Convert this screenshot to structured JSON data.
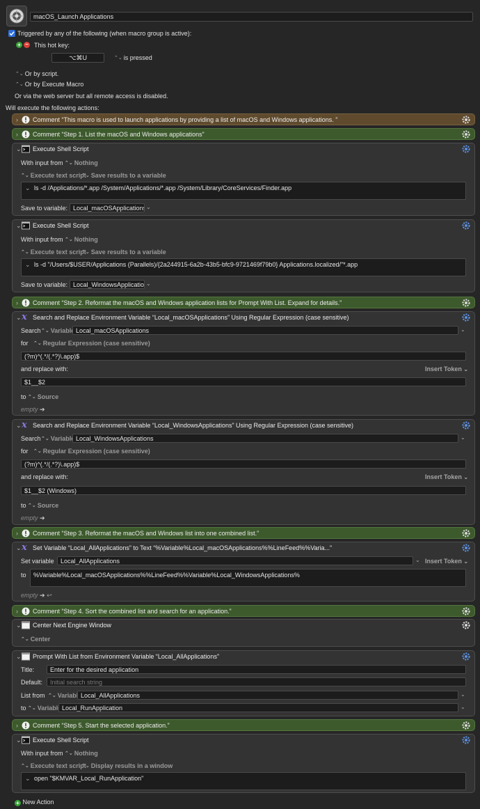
{
  "macro": {
    "name": "macOS_Launch Applications",
    "trigger_checkbox_label": "Triggered by any of the following (when macro group is active):",
    "hotkey_label": "This hot key:",
    "hotkey_value": "⌥⌘U",
    "hotkey_state": "is pressed",
    "or_by_script": "Or by script.",
    "or_by_execute_macro": "Or by Execute Macro",
    "web_server_note": "Or via the web server but all remote access is disabled.",
    "will_execute": "Will execute the following actions:"
  },
  "actions": {
    "comment1": "Comment “This macro is used to launch applications by providing a list of macOS and Windows applications.  ”",
    "comment2": "Comment “Step 1. List the macOS and Windows applications”",
    "shell1": {
      "title": "Execute Shell Script",
      "with_input_label": "With input from",
      "with_input_value": "Nothing",
      "option1": "Execute text script",
      "option2": "Save results to a variable",
      "script": "ls -d /Applications/*.app /System/Applications/*.app /System/Library/CoreServices/Finder.app",
      "save_label": "Save to variable:",
      "save_value": "Local_macOSApplications"
    },
    "shell2": {
      "title": "Execute Shell Script",
      "with_input_label": "With input from",
      "with_input_value": "Nothing",
      "option1": "Execute text script",
      "option2": "Save results to a variable",
      "script": "ls -d \"/Users/$USER/Applications (Parallels)/{2a244915-6a2b-43b5-bfc9-9721469f79b0} Applications.localized/\"*.app",
      "save_label": "Save to variable:",
      "save_value": "Local_WindowsApplication"
    },
    "comment3": "Comment “Step 2. Reformat the macOS and Windows application lists for Prompt With List. Expand for details.”",
    "sr1": {
      "title": "Search and Replace Environment Variable “Local_macOSApplications” Using Regular Expression (case sensitive)",
      "search_label": "Search",
      "search_type": "Variable",
      "search_value": "Local_macOSApplications",
      "for_label": "for",
      "for_type": "Regular Expression (case sensitive)",
      "regex": "(?m)^(.*/(.*?)\\.app)$",
      "replace_label": "and replace with:",
      "insert_token": "Insert Token",
      "replace_value": "$1__$2",
      "to_label": "to",
      "to_value": "Source",
      "empty": "empty"
    },
    "sr2": {
      "title": "Search and Replace Environment Variable “Local_WindowsApplications” Using Regular Expression (case sensitive)",
      "search_label": "Search",
      "search_type": "Variable",
      "search_value": "Local_WindowsApplications",
      "for_label": "for",
      "for_type": "Regular Expression (case sensitive)",
      "regex": "(?m)^(.*/(.*?)\\.app)$",
      "replace_label": "and replace with:",
      "insert_token": "Insert Token",
      "replace_value": "$1__$2 (Windows)",
      "to_label": "to",
      "to_value": "Source",
      "empty": "empty"
    },
    "comment4": "Comment “Step 3. Reformat the macOS and Windows list into one combined list.”",
    "setvar": {
      "title": "Set Variable “Local_AllApplications” to Text “%Variable%Local_macOSApplications%%LineFeed%%Varia...”",
      "set_label": "Set variable",
      "set_value": "Local_AllApplications",
      "insert_token": "Insert Token",
      "to_label": "to",
      "to_value": "%Variable%Local_macOSApplications%%LineFeed%%Variable%Local_WindowsApplications%",
      "empty": "empty"
    },
    "comment5": "Comment “Step 4. Sort the combined list and search for an application.”",
    "center": {
      "title": "Center Next Engine Window",
      "option": "Center"
    },
    "prompt": {
      "title": "Prompt With List from Environment Variable “Local_AllApplications”",
      "title_label": "Title:",
      "title_value": "Enter for the desired application",
      "default_label": "Default:",
      "default_placeholder": "Initial search string",
      "list_label": "List from",
      "list_type": "Variable",
      "list_value": "Local_AllApplications",
      "to_label": "to",
      "to_type": "Variable",
      "to_value": "Local_RunApplication"
    },
    "comment6": "Comment “Step 5. Start the selected  application.”",
    "shell3": {
      "title": "Execute Shell Script",
      "with_input_label": "With input from",
      "with_input_value": "Nothing",
      "option1": "Execute text script",
      "option2": "Display results in a window",
      "script": "open \"$KMVAR_Local_RunApplication\""
    }
  },
  "new_action": "New Action",
  "colors": {
    "background": "#262626",
    "card": "#333333",
    "comment_brown": "#5f4a2d",
    "comment_green": "#3d5a2d",
    "accent_blue": "#2f6fdb"
  },
  "icons": [
    "macro-icon",
    "terminal-icon",
    "variable-x-icon",
    "window-icon",
    "alert-icon",
    "gear-icon",
    "add-icon",
    "remove-icon"
  ]
}
